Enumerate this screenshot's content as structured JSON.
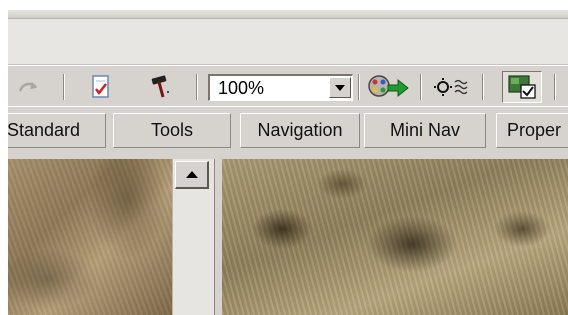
{
  "toolbar": {
    "buttons": [
      {
        "icon": "redo-icon"
      },
      {
        "icon": "check-document-icon"
      },
      {
        "icon": "hammer-icon"
      },
      {
        "icon": "film-reel-arrow-icon"
      },
      {
        "icon": "wave-sensor-icon"
      },
      {
        "icon": "image-checkbox-icon"
      }
    ],
    "zoom": {
      "value": "100%",
      "icon": "chevron-down-icon"
    }
  },
  "tabs": [
    {
      "label": "Standard"
    },
    {
      "label": "Tools"
    },
    {
      "label": "Navigation"
    },
    {
      "label": "Mini Nav"
    },
    {
      "label": "Proper"
    }
  ],
  "scrollbar": {
    "up_icon": "triangle-up-icon"
  },
  "colors": {
    "chrome": "#d6d3ce",
    "menu_band": "#e8e6e2",
    "field_bg": "#ffffff",
    "check_red": "#cc2222",
    "arrow_green": "#1f9a2e"
  }
}
